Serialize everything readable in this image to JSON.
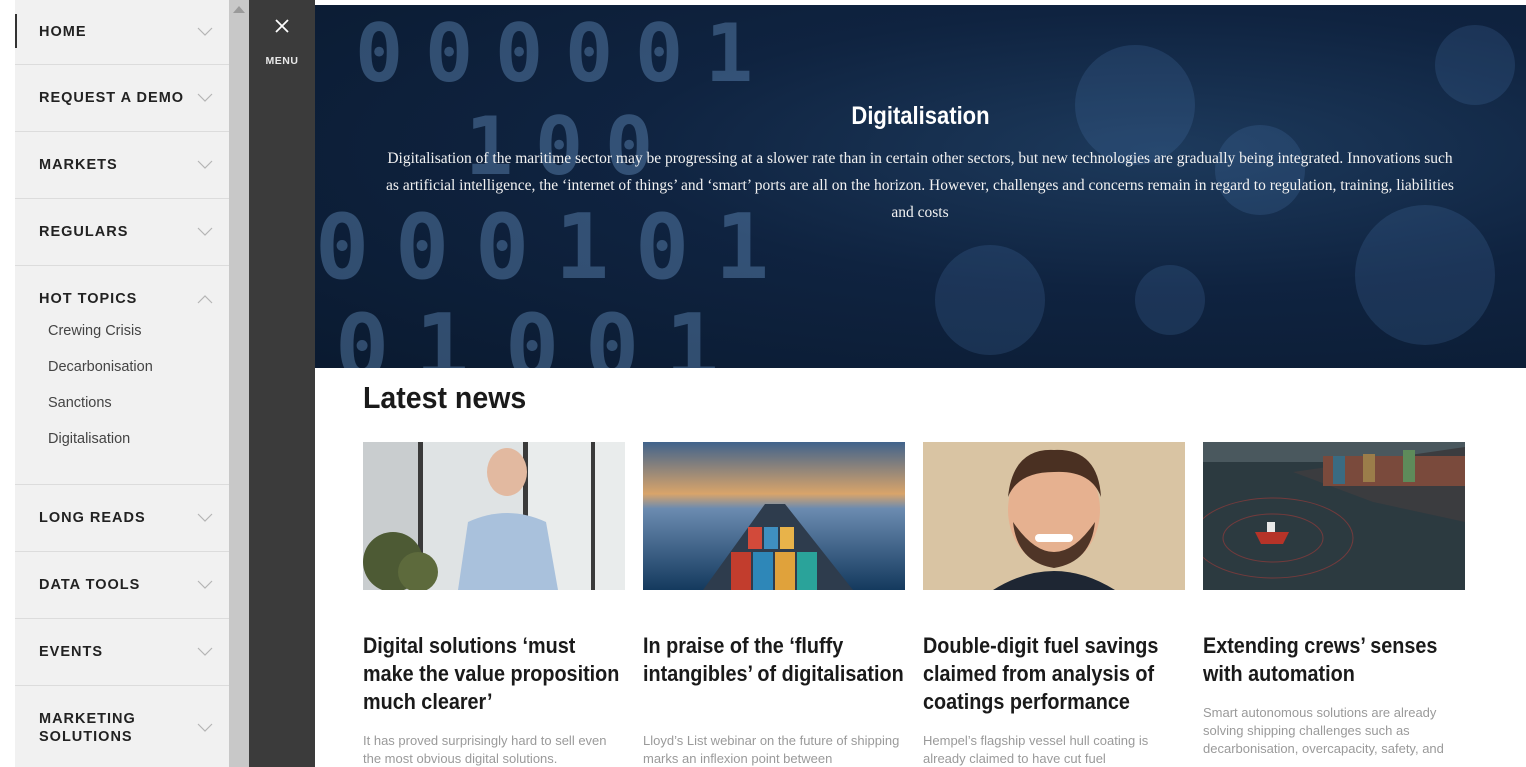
{
  "menu": {
    "close_label": "MENU",
    "items": [
      {
        "label": "HOME",
        "expanded": false
      },
      {
        "label": "REQUEST A DEMO",
        "expanded": false
      },
      {
        "label": "MARKETS",
        "expanded": false
      },
      {
        "label": "REGULARS",
        "expanded": false
      },
      {
        "label": "HOT TOPICS",
        "expanded": true,
        "children": [
          "Crewing Crisis",
          "Decarbonisation",
          "Sanctions",
          "Digitalisation"
        ]
      },
      {
        "label": "LONG READS",
        "expanded": false
      },
      {
        "label": "DATA TOOLS",
        "expanded": false
      },
      {
        "label": "EVENTS",
        "expanded": false
      },
      {
        "label": "MARKETING SOLUTIONS",
        "label_line1": "MARKETING",
        "label_line2": "SOLUTIONS",
        "expanded": false
      }
    ]
  },
  "hero": {
    "title": "Digitalisation",
    "description": "Digitalisation of the maritime sector may be progressing at a slower rate than in certain other sectors, but new technologies are gradually being integrated. Innovations such as artificial intelligence, the ‘internet of things’ and ‘smart’ ports are all on the horizon. However, challenges and concerns remain in regard to regulation, training, liabilities and costs"
  },
  "latest_news": {
    "title": "Latest news",
    "articles": [
      {
        "headline": "Digital solutions ‘must make the value proposition much clearer’",
        "teaser": "It has proved surprisingly hard to sell even the most obvious digital solutions."
      },
      {
        "headline": "In praise of the ‘fluffy intangibles’ of digitalisation",
        "teaser": "Lloyd’s List webinar on the future of shipping marks an inflexion point between"
      },
      {
        "headline": "Double-digit fuel savings claimed from analysis of coatings performance",
        "teaser": "Hempel’s flagship vessel hull coating is already claimed to have cut fuel"
      },
      {
        "headline": "Extending crews’ senses with automation",
        "teaser": "Smart autonomous solutions are already solving shipping challenges such as decarbonisation, overcapacity, safety, and"
      }
    ]
  },
  "colors": {
    "sidebar_bg": "#f1f1f1",
    "menu_column_bg": "#3b3b3b",
    "scrollbar_bg": "#c8c8c8",
    "hero_bg": "#0f2340"
  }
}
